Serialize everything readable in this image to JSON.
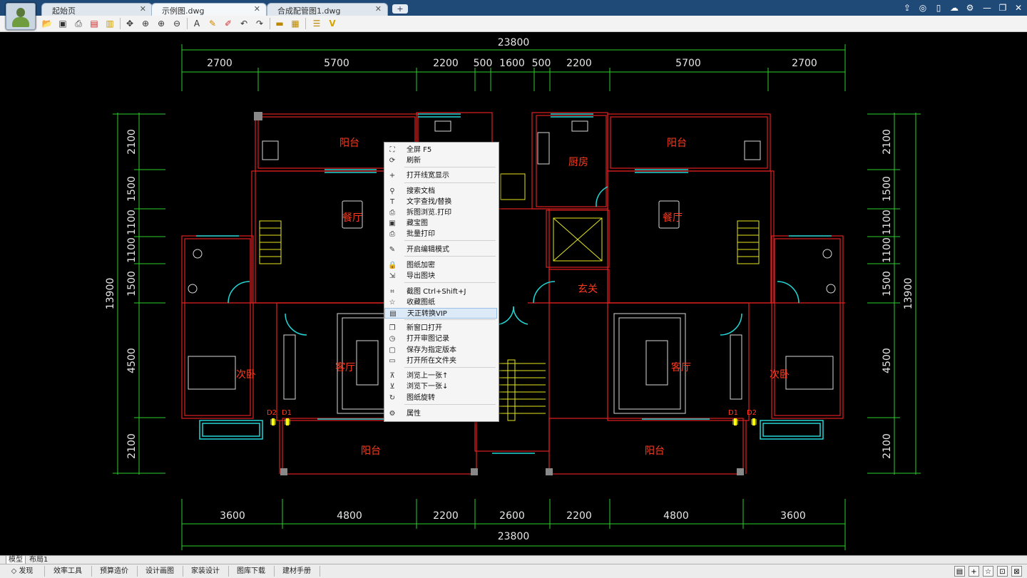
{
  "window": {
    "tabs": [
      {
        "title": "起始页"
      },
      {
        "title": "示例图.dwg"
      },
      {
        "title": "合成配管图1.dwg"
      }
    ],
    "new_tab": "+"
  },
  "menu": [
    {
      "label": "全屏 F5",
      "icon": "fullscreen-icon",
      "g": "⛶"
    },
    {
      "label": "刷新",
      "icon": "refresh-icon",
      "g": "⟳"
    },
    {
      "label": "打开线宽显示",
      "icon": "lineweight-icon",
      "g": "+"
    },
    {
      "label": "搜索文档",
      "icon": "search-icon",
      "g": "⚲"
    },
    {
      "label": "文字查找/替换",
      "icon": "text-icon",
      "g": "T"
    },
    {
      "label": "拆图浏览.打印",
      "icon": "print-split-icon",
      "g": "⎙"
    },
    {
      "label": "藏宝图",
      "icon": "map-icon",
      "g": "▣"
    },
    {
      "label": "批量打印",
      "icon": "batch-print-icon",
      "g": "⎙"
    },
    {
      "label": "开启编辑模式",
      "icon": "edit-icon",
      "g": "✎"
    },
    {
      "label": "图纸加密",
      "icon": "lock-icon",
      "g": "🔒"
    },
    {
      "label": "导出图块",
      "icon": "export-icon",
      "g": "⇲"
    },
    {
      "label": "截图 Ctrl+Shift+J",
      "icon": "crop-icon",
      "g": "⌗"
    },
    {
      "label": "收藏图纸",
      "icon": "star-icon",
      "g": "☆"
    },
    {
      "label": "天正转换VIP",
      "icon": "convert-icon",
      "g": "▤"
    },
    {
      "label": "新窗口打开",
      "icon": "new-window-icon",
      "g": "❐"
    },
    {
      "label": "打开审图记录",
      "icon": "history-icon",
      "g": "◷"
    },
    {
      "label": "保存为指定版本",
      "icon": "save-icon",
      "g": "▢"
    },
    {
      "label": "打开所在文件夹",
      "icon": "folder-icon",
      "g": "▭"
    },
    {
      "label": "浏览上一张↑",
      "icon": "prev-icon",
      "g": "⊼"
    },
    {
      "label": "浏览下一张↓",
      "icon": "next-icon",
      "g": "⊻"
    },
    {
      "label": "图纸旋转",
      "icon": "rotate-icon",
      "g": "↻"
    },
    {
      "label": "属性",
      "icon": "properties-icon",
      "g": "⚙"
    }
  ],
  "drawing": {
    "top_total": "23800",
    "top_dims": [
      "2700",
      "5700",
      "2200",
      "500",
      "1600",
      "500",
      "2200",
      "5700",
      "2700"
    ],
    "bottom_dims": [
      "3600",
      "4800",
      "2200",
      "2600",
      "2200",
      "4800",
      "3600"
    ],
    "bottom_total": "23800",
    "left_dims": [
      "2100",
      "1500",
      "1100",
      "1100",
      "1500",
      "4500",
      "2100"
    ],
    "left_total": "13900",
    "right_dims": [
      "2100",
      "1500",
      "1100",
      "1100",
      "1500",
      "4500",
      "2100"
    ],
    "right_total": "13900",
    "rooms": {
      "balcony_tl": "阳台",
      "balcony_tr": "阳台",
      "kitchen": "厨房",
      "dining_l": "餐厅",
      "dining_r": "餐厅",
      "foyer": "玄关",
      "living_l": "客厅",
      "living_r": "客厅",
      "bedroom_l": "次卧",
      "bedroom_r": "次卧",
      "balcony_bl": "阳台",
      "balcony_br": "阳台"
    },
    "door_labels": {
      "d2_l": "D2",
      "d1_l": "D1",
      "d1_r": "D1",
      "d2_r": "D2"
    }
  },
  "layout_tabs": [
    "模型",
    "布局1"
  ],
  "statusbar": [
    "发现",
    "效率工具",
    "预算造价",
    "设计画图",
    "家装设计",
    "图库下载",
    "建材手册"
  ]
}
